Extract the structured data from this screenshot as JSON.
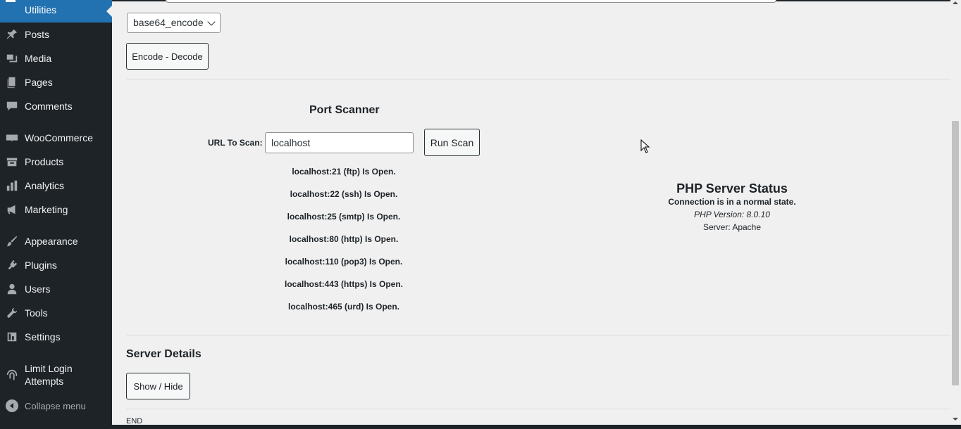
{
  "sidebar": {
    "active_label": "Utilities",
    "items": [
      {
        "label": "Posts",
        "icon": "pin-icon"
      },
      {
        "label": "Media",
        "icon": "media-icon"
      },
      {
        "label": "Pages",
        "icon": "pages-icon"
      },
      {
        "label": "Comments",
        "icon": "comment-icon"
      },
      {
        "label": "WooCommerce",
        "icon": "woo-icon"
      },
      {
        "label": "Products",
        "icon": "archive-icon"
      },
      {
        "label": "Analytics",
        "icon": "bar-chart-icon"
      },
      {
        "label": "Marketing",
        "icon": "megaphone-icon"
      },
      {
        "label": "Appearance",
        "icon": "paintbrush-icon"
      },
      {
        "label": "Plugins",
        "icon": "plugin-icon"
      },
      {
        "label": "Users",
        "icon": "user-icon"
      },
      {
        "label": "Tools",
        "icon": "wrench-icon"
      },
      {
        "label": "Settings",
        "icon": "settings-icon"
      },
      {
        "label": "Limit Login Attempts",
        "icon": "fingerprint-icon"
      }
    ],
    "collapse_label": "Collapse menu"
  },
  "encoder": {
    "select_value": "base64_encode",
    "button_label": "Encode - Decode"
  },
  "port_scanner": {
    "title": "Port Scanner",
    "url_label": "URL To Scan:",
    "url_value": "localhost",
    "run_label": "Run Scan",
    "results": [
      "localhost:21 (ftp) Is Open.",
      "localhost:22 (ssh) Is Open.",
      "localhost:25 (smtp) Is Open.",
      "localhost:80 (http) Is Open.",
      "localhost:110 (pop3) Is Open.",
      "localhost:443 (https) Is Open.",
      "localhost:465 (urd) Is Open."
    ]
  },
  "php_status": {
    "title": "PHP Server Status",
    "connection": "Connection is in a normal state.",
    "version": "PHP Version: 8.0.10",
    "server": "Server: Apache"
  },
  "server_details": {
    "title": "Server Details",
    "toggle_label": "Show / Hide"
  },
  "footer": {
    "end_text": "END"
  },
  "colors": {
    "sidebar_bg": "#1d2327",
    "active_bg": "#2271b1",
    "page_bg": "#f0f0f1"
  }
}
